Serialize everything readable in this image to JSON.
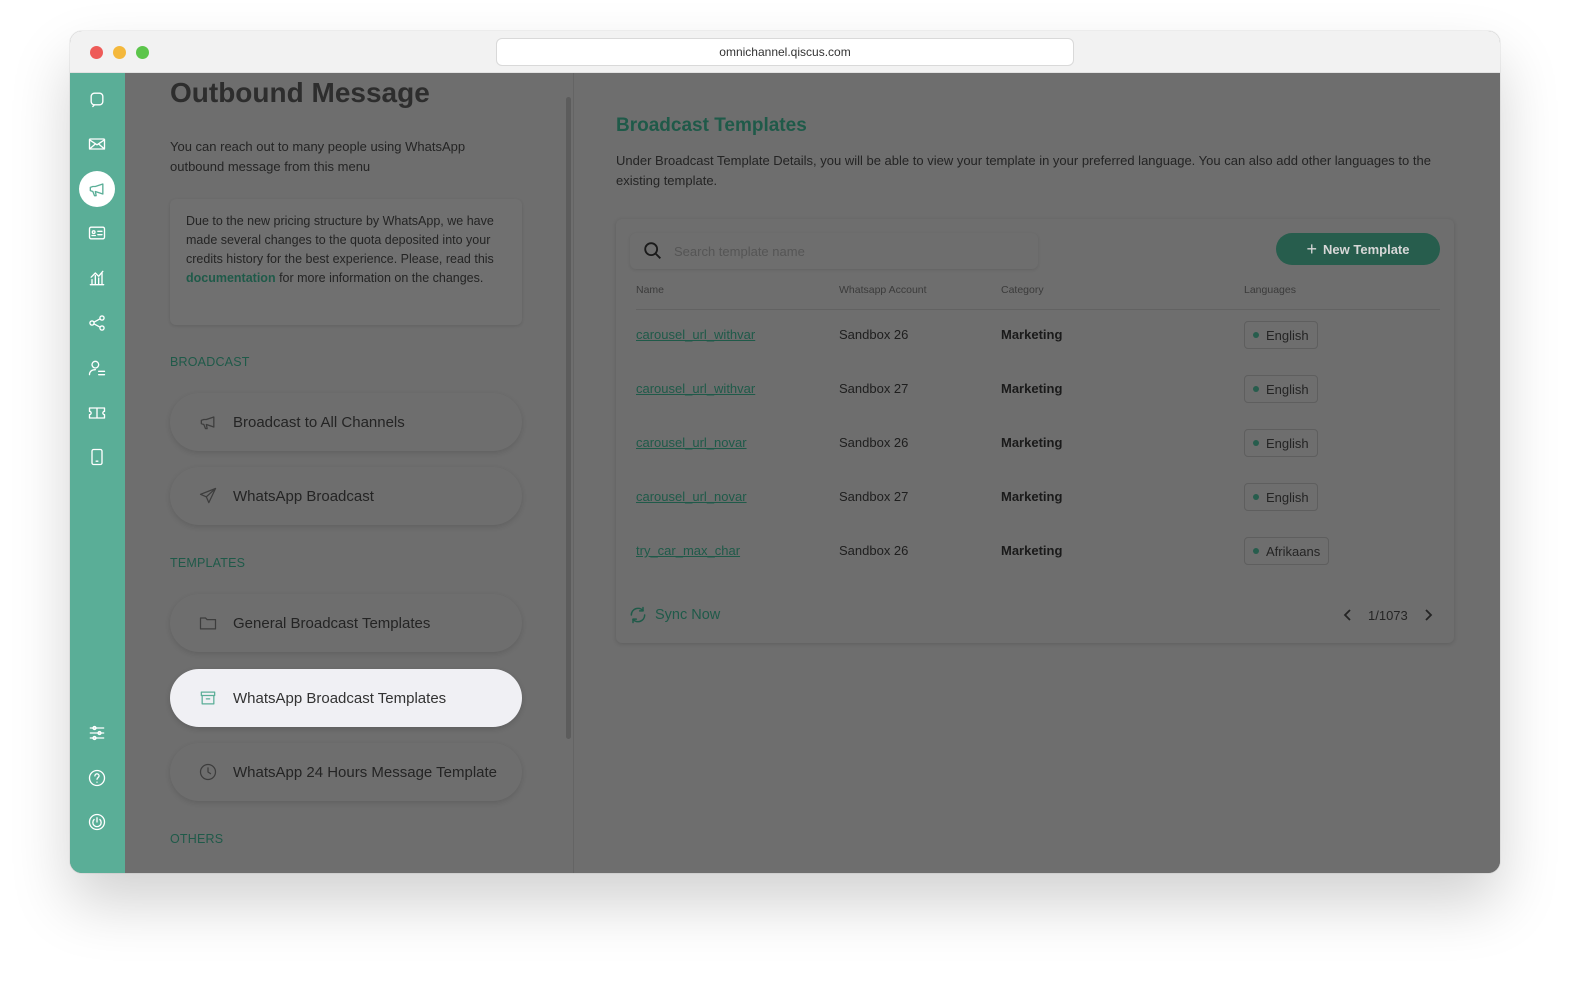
{
  "browser": {
    "url": "omnichannel.qiscus.com"
  },
  "left": {
    "title": "Outbound Message",
    "description": "You can reach out to many people using WhatsApp outbound message from this menu",
    "notice": {
      "before": "Due to the new pricing structure by WhatsApp, we have made several changes to the quota deposited into your credits history for the best experience. Please, read this ",
      "link": "documentation",
      "after": " for more information on the changes."
    },
    "sections": {
      "broadcast": "BROADCAST",
      "templates": "TEMPLATES",
      "others": "OTHERS"
    },
    "items": {
      "broadcast_all": "Broadcast to All Channels",
      "whatsapp_broadcast": "WhatsApp Broadcast",
      "general_templates": "General Broadcast Templates",
      "whatsapp_templates": "WhatsApp Broadcast Templates",
      "whatsapp_24h": "WhatsApp 24 Hours Message Template"
    }
  },
  "right": {
    "title": "Broadcast Templates",
    "description": "Under Broadcast Template Details, you will be able to view your template in your preferred language. You can also add other languages to the existing template.",
    "search": {
      "placeholder": "Search template name"
    },
    "new_button": "New Template",
    "columns": {
      "name": "Name",
      "account": "Whatsapp Account",
      "category": "Category",
      "languages": "Languages"
    },
    "rows": [
      {
        "name": "carousel_url_withvar",
        "account": "Sandbox 26",
        "category": "Marketing",
        "language": "English"
      },
      {
        "name": "carousel_url_withvar",
        "account": "Sandbox 27",
        "category": "Marketing",
        "language": "English"
      },
      {
        "name": "carousel_url_novar",
        "account": "Sandbox 26",
        "category": "Marketing",
        "language": "English"
      },
      {
        "name": "carousel_url_novar",
        "account": "Sandbox 27",
        "category": "Marketing",
        "language": "English"
      },
      {
        "name": "try_car_max_char",
        "account": "Sandbox 26",
        "category": "Marketing",
        "language": "Afrikaans"
      }
    ],
    "sync_label": "Sync Now",
    "pagination": "1/1073"
  },
  "colors": {
    "sidebar": "#5aae97",
    "accent_dark": "#275d4d",
    "overlay": "#6e6e6e"
  }
}
